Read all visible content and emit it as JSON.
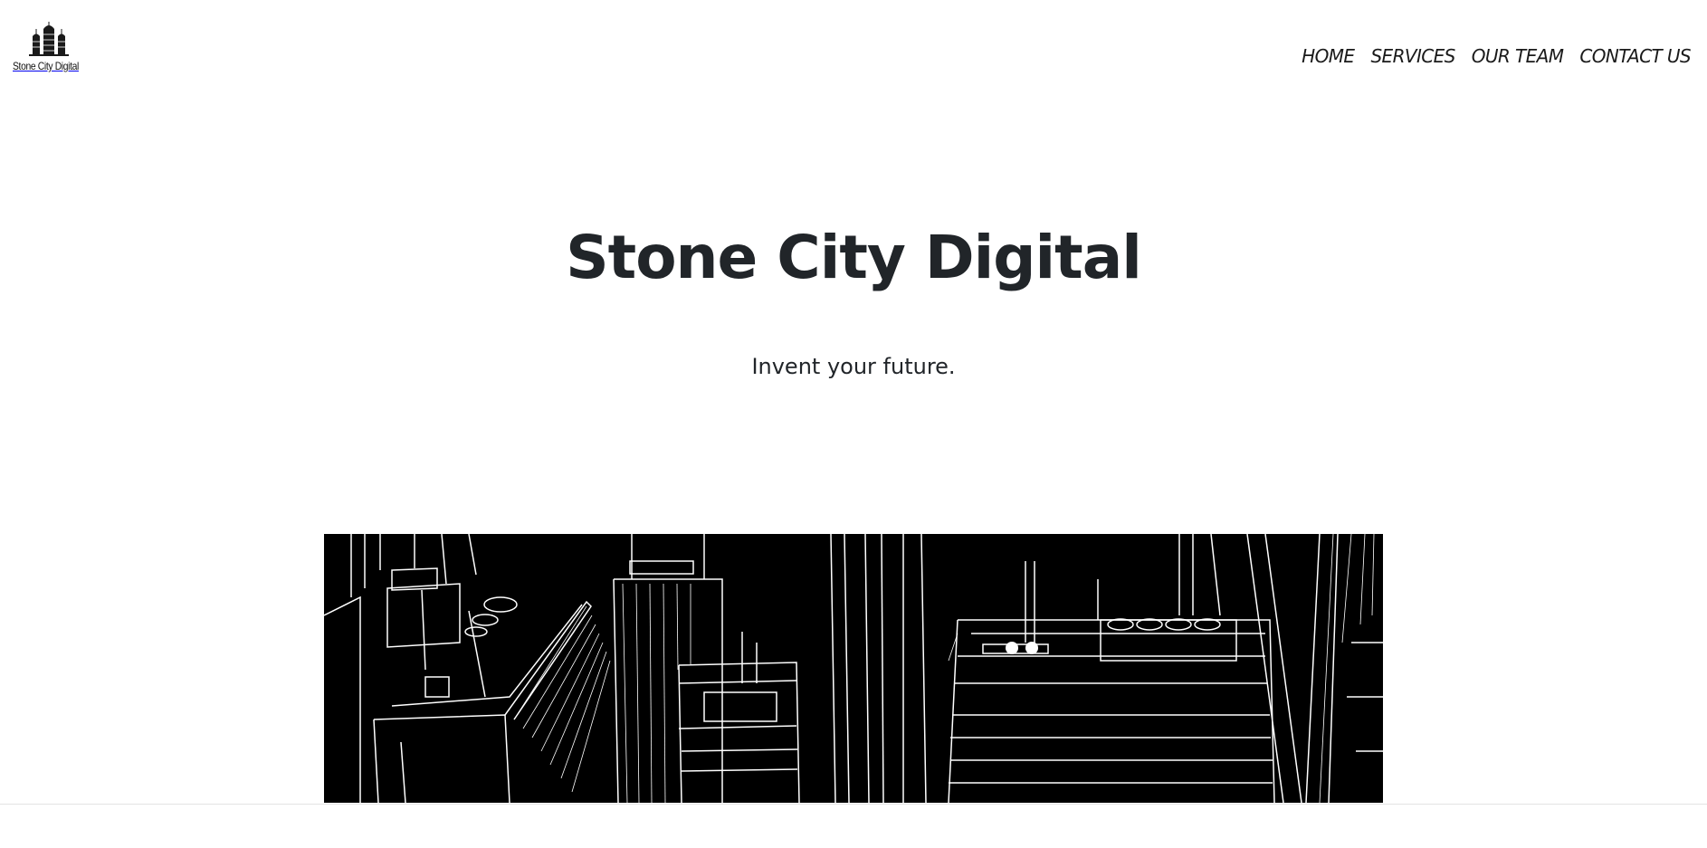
{
  "brand": {
    "logo_text": "Stone City Digital",
    "logo_icon": "city-skyline-icon"
  },
  "nav": {
    "items": [
      {
        "label": "HOME"
      },
      {
        "label": "SERVICES"
      },
      {
        "label": "OUR TEAM"
      },
      {
        "label": "CONTACT US"
      }
    ]
  },
  "hero": {
    "title": "Stone City Digital",
    "tagline": "Invent your future.",
    "image_subject": "aerial line-art of city skyscrapers",
    "image_colors": {
      "background": "#000000",
      "lines": "#ffffff"
    }
  },
  "colors": {
    "page_background": "#ffffff",
    "text": "#212529",
    "nav_text": "#1a1a1a"
  }
}
